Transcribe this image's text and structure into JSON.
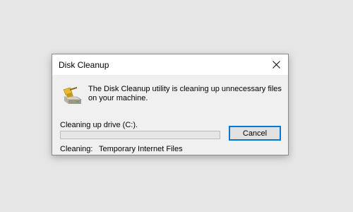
{
  "dialog": {
    "title": "Disk Cleanup",
    "message": "The Disk Cleanup utility is cleaning up unnecessary files on your machine.",
    "status": "Cleaning up drive  (C:).",
    "progress": 0,
    "cancel_label": "Cancel",
    "cleaning_label": "Cleaning:",
    "cleaning_value": "Temporary Internet Files",
    "icons": {
      "close": "close-icon",
      "app": "disk-cleanup-icon"
    }
  },
  "colors": {
    "desktop": "#e6e6e6",
    "dialog_body": "#f0f0f0",
    "titlebar": "#ffffff",
    "focus_border": "#0078d7",
    "progress_fill": "#06b025"
  }
}
